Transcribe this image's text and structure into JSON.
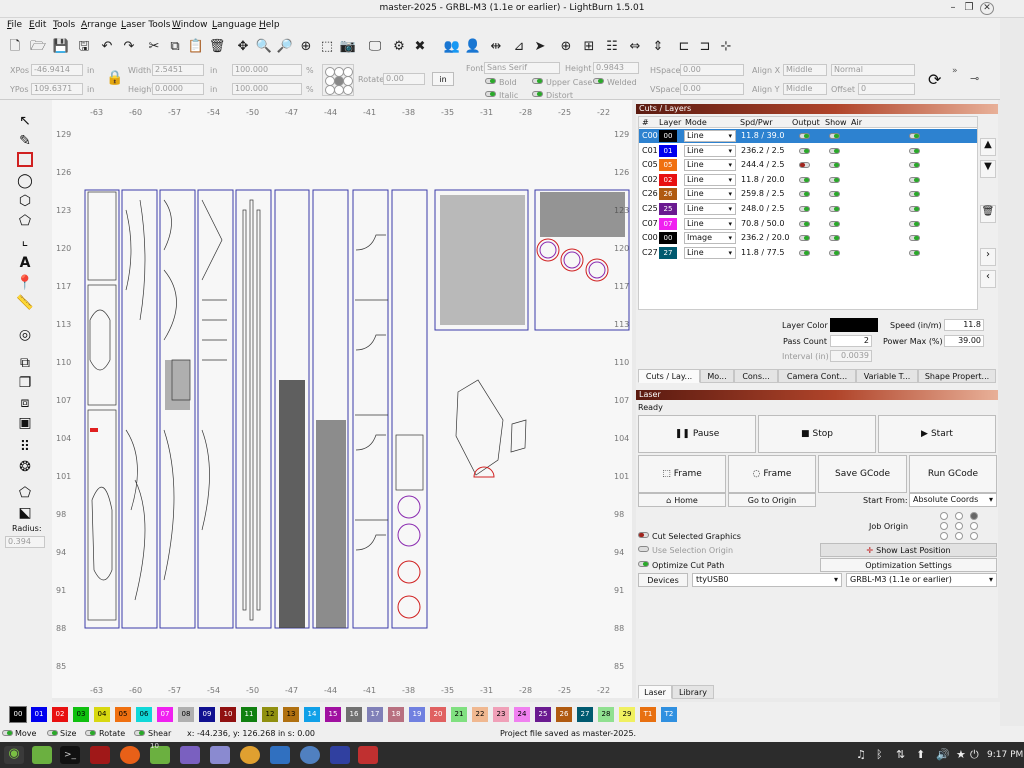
{
  "window": {
    "title": "master-2025 - GRBL-M3 (1.1e or earlier) - LightBurn 1.5.01",
    "min_icon": "minimize-icon",
    "max_icon": "maximize-icon",
    "close_icon": "close-icon"
  },
  "menu": [
    "File",
    "Edit",
    "Tools",
    "Arrange",
    "Laser Tools",
    "Window",
    "Language",
    "Help"
  ],
  "toolbar_icons": [
    "new-file-icon",
    "open-folder-icon",
    "save-icon",
    "save-as-icon",
    "undo-icon",
    "redo-icon",
    "cut-icon",
    "copy-icon",
    "paste-icon",
    "delete-icon",
    "move-icon",
    "zoom-in-icon",
    "zoom-out-icon",
    "zoom-fit-icon",
    "zoom-frame-icon",
    "camera-icon",
    "monitor-icon",
    "settings-icon",
    "tools-icon",
    "group-icon",
    "user-icon",
    "mirror-icon",
    "mirror-v-icon",
    "send-icon",
    "target-icon",
    "align-icon",
    "distribute-icon",
    "hdistribute-icon",
    "vdistribute-icon",
    "align-center-icon"
  ],
  "props": {
    "xpos_label": "XPos",
    "xpos": "-46.9414",
    "xpos_unit": "in",
    "ypos_label": "YPos",
    "ypos": "109.6371",
    "ypos_unit": "in",
    "width_label": "Width",
    "width": "2.5451",
    "width_unit": "in",
    "height_label": "Height",
    "height": "0.0000",
    "height_unit": "in",
    "scale_w": "100.000",
    "scale_h": "100.000",
    "pct": "%",
    "rotate_label": "Rotate",
    "rotate": "0.00",
    "in_btn": "in",
    "font_label": "Font",
    "font": "Sans Serif",
    "fheight_label": "Height",
    "fheight": "0.9843",
    "bold": "Bold",
    "italic": "Italic",
    "upper": "Upper Case",
    "distort": "Distort",
    "welded": "Welded",
    "hspace_label": "HSpace",
    "hspace": "0.00",
    "vspace_label": "VSpace",
    "vspace": "0.00",
    "alignx_label": "Align X",
    "alignx": "Middle",
    "aligny_label": "Align Y",
    "aligny": "Middle",
    "normal": "Normal",
    "offset_label": "Offset",
    "offset": "0"
  },
  "lefttools": {
    "radius_label": "Radius:",
    "radius": "0.394",
    "text_tool": "A"
  },
  "ruler": {
    "top": [
      "-63",
      "-60",
      "-57",
      "-54",
      "-50",
      "-47",
      "-44",
      "-41",
      "-38",
      "-35",
      "-31",
      "-28",
      "-25",
      "-22"
    ],
    "left": [
      "129",
      "126",
      "123",
      "120",
      "117",
      "113",
      "110",
      "107",
      "104",
      "101",
      "98",
      "94",
      "91",
      "88",
      "85"
    ]
  },
  "cuts_panel": {
    "title": "Cuts / Layers",
    "headers": {
      "num": "#",
      "layer": "Layer",
      "mode": "Mode",
      "spd": "Spd/Pwr",
      "output": "Output",
      "show": "Show",
      "air": "Air"
    },
    "rows": [
      {
        "c": "C00",
        "n": "00",
        "color": "#000000",
        "mode": "Line",
        "sp": "11.8 / 39.0",
        "out": "on",
        "selected": true
      },
      {
        "c": "C01",
        "n": "01",
        "color": "#0000ee",
        "mode": "Line",
        "sp": "236.2 / 2.5",
        "out": "on"
      },
      {
        "c": "C05",
        "n": "05",
        "color": "#f07010",
        "mode": "Line",
        "sp": "244.4 / 2.5",
        "out": "off"
      },
      {
        "c": "C02",
        "n": "02",
        "color": "#e81010",
        "mode": "Line",
        "sp": "11.8 / 20.0",
        "out": "on"
      },
      {
        "c": "C26",
        "n": "26",
        "color": "#b05a10",
        "mode": "Line",
        "sp": "259.8 / 2.5",
        "out": "on"
      },
      {
        "c": "C25",
        "n": "25",
        "color": "#6a1a90",
        "mode": "Line",
        "sp": "248.0 / 2.5",
        "out": "on"
      },
      {
        "c": "C07",
        "n": "07",
        "color": "#f020f0",
        "mode": "Line",
        "sp": "70.8 / 50.0",
        "out": "on"
      },
      {
        "c": "C00",
        "n": "00",
        "color": "#000000",
        "mode": "Image",
        "sp": "236.2 / 20.0",
        "out": "on"
      },
      {
        "c": "C27",
        "n": "27",
        "color": "#005a70",
        "mode": "Line",
        "sp": "11.8 / 77.5",
        "out": "on"
      }
    ],
    "layer_color_label": "Layer Color",
    "speed_label": "Speed (in/m)",
    "speed": "11.8",
    "pass_label": "Pass Count",
    "pass": "2",
    "power_label": "Power Max (%)",
    "power": "39.00",
    "interval_label": "Interval (in)",
    "interval": "0.0039"
  },
  "panel_tabs": [
    "Cuts / Lay...",
    "Mo...",
    "Cons...",
    "Camera Cont...",
    "Variable T...",
    "Shape Propert..."
  ],
  "laser": {
    "title": "Laser",
    "status": "Ready",
    "pause": "Pause",
    "stop": "Stop",
    "start": "Start",
    "frame1": "Frame",
    "frame2": "Frame",
    "save_gcode": "Save GCode",
    "run_gcode": "Run GCode",
    "home": "Home",
    "go_origin": "Go to Origin",
    "start_from_label": "Start From:",
    "start_from": "Absolute Coords",
    "job_origin_label": "Job Origin",
    "cut_selected": "Cut Selected Graphics",
    "use_selection": "Use Selection Origin",
    "show_last": "Show Last Position",
    "optimize": "Optimize Cut Path",
    "opt_settings": "Optimization Settings",
    "devices": "Devices",
    "port": "ttyUSB0",
    "device": "GRBL-M3 (1.1e or earlier)"
  },
  "bottom_tabs": [
    "Laser",
    "Library"
  ],
  "palette": [
    {
      "l": "00",
      "c": "#000000",
      "t": "#fff"
    },
    {
      "l": "01",
      "c": "#0000ee",
      "t": "#fff"
    },
    {
      "l": "02",
      "c": "#e81010",
      "t": "#fff"
    },
    {
      "l": "03",
      "c": "#10c010",
      "t": "#000"
    },
    {
      "l": "04",
      "c": "#d8d810",
      "t": "#000"
    },
    {
      "l": "05",
      "c": "#f07010",
      "t": "#000"
    },
    {
      "l": "06",
      "c": "#10d8d8",
      "t": "#000"
    },
    {
      "l": "07",
      "c": "#f020f0",
      "t": "#fff"
    },
    {
      "l": "08",
      "c": "#b0b0b0",
      "t": "#000"
    },
    {
      "l": "09",
      "c": "#101090",
      "t": "#fff"
    },
    {
      "l": "10",
      "c": "#901010",
      "t": "#fff"
    },
    {
      "l": "11",
      "c": "#108010",
      "t": "#fff"
    },
    {
      "l": "12",
      "c": "#909010",
      "t": "#000"
    },
    {
      "l": "13",
      "c": "#b07010",
      "t": "#000"
    },
    {
      "l": "14",
      "c": "#10a0e8",
      "t": "#fff"
    },
    {
      "l": "15",
      "c": "#a010a0",
      "t": "#fff"
    },
    {
      "l": "16",
      "c": "#707070",
      "t": "#fff"
    },
    {
      "l": "17",
      "c": "#8080b8",
      "t": "#fff"
    },
    {
      "l": "18",
      "c": "#b87080",
      "t": "#fff"
    },
    {
      "l": "19",
      "c": "#7080e0",
      "t": "#fff"
    },
    {
      "l": "20",
      "c": "#e06060",
      "t": "#fff"
    },
    {
      "l": "21",
      "c": "#80e080",
      "t": "#000"
    },
    {
      "l": "22",
      "c": "#f0b890",
      "t": "#000"
    },
    {
      "l": "23",
      "c": "#f0a0b8",
      "t": "#000"
    },
    {
      "l": "24",
      "c": "#f080f0",
      "t": "#000"
    },
    {
      "l": "25",
      "c": "#6a1a90",
      "t": "#fff"
    },
    {
      "l": "26",
      "c": "#b05a10",
      "t": "#fff"
    },
    {
      "l": "27",
      "c": "#005a70",
      "t": "#fff"
    },
    {
      "l": "28",
      "c": "#90e090",
      "t": "#000"
    },
    {
      "l": "29",
      "c": "#f0f060",
      "t": "#000"
    },
    {
      "l": "T1",
      "c": "#e87010",
      "t": "#fff"
    },
    {
      "l": "T2",
      "c": "#3090e0",
      "t": "#fff"
    }
  ],
  "status": {
    "move": "Move",
    "size": "Size",
    "rotate": "Rotate",
    "shear": "Shear",
    "coords": "x: -44.236, y: 126.268 in  s: 0.00",
    "message": "Project file saved as master-2025."
  },
  "taskbar": {
    "clock": "9:17 PM",
    "badge": "10"
  }
}
